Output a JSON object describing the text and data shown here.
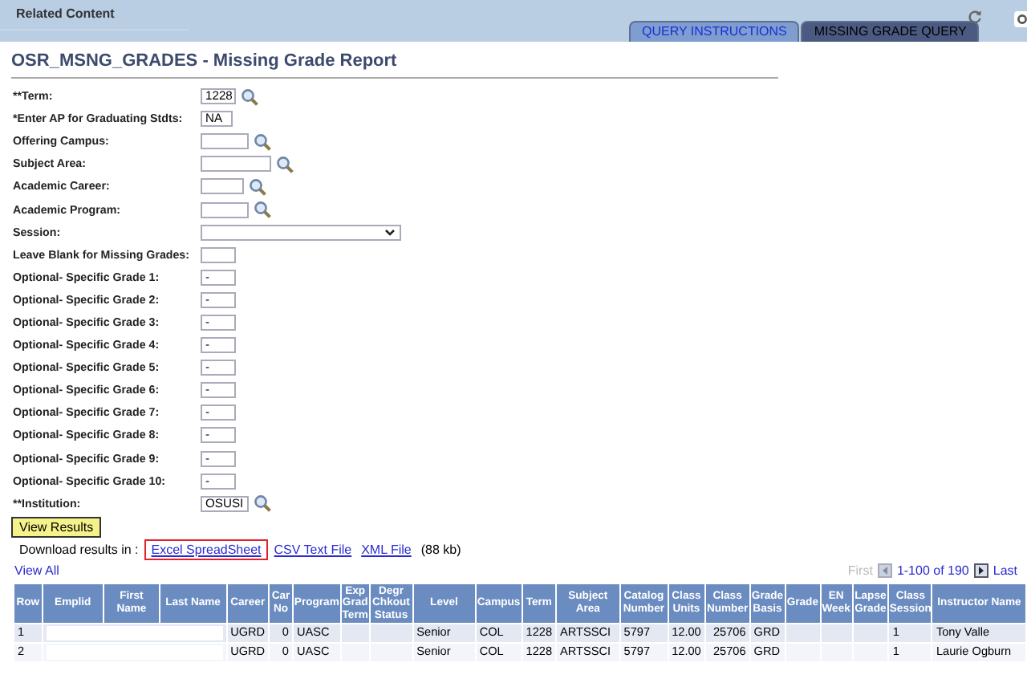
{
  "header": {
    "title": "Related Content"
  },
  "tabs": [
    {
      "label": "QUERY INSTRUCTIONS",
      "selected": false
    },
    {
      "label": "MISSING GRADE QUERY",
      "selected": true
    }
  ],
  "report_title": "OSR_MSNG_GRADES - Missing Grade Report",
  "fields": [
    {
      "label": "**Term:",
      "kind": "lookup",
      "value": "1228"
    },
    {
      "label": "*Enter AP for Graduating Stdts:",
      "kind": "text",
      "value": "NA"
    },
    {
      "label": "Offering Campus:",
      "kind": "lookup"
    },
    {
      "label": "Subject Area:",
      "kind": "lookup"
    },
    {
      "label": "Academic Career:",
      "kind": "lookup"
    },
    {
      "label": "Academic Program:",
      "kind": "lookup"
    },
    {
      "label": "Session:",
      "kind": "select"
    },
    {
      "label": "Leave Blank for Missing Grades:",
      "kind": "text"
    },
    {
      "label": "Optional- Specific Grade 1:",
      "kind": "text",
      "value": "-"
    },
    {
      "label": "Optional- Specific Grade 2:",
      "kind": "text",
      "value": "-"
    },
    {
      "label": "Optional- Specific Grade 3:",
      "kind": "text",
      "value": "-"
    },
    {
      "label": "Optional- Specific Grade 4:",
      "kind": "text",
      "value": "-"
    },
    {
      "label": "Optional- Specific Grade 5:",
      "kind": "text",
      "value": "-"
    },
    {
      "label": "Optional- Specific Grade 6:",
      "kind": "text",
      "value": "-"
    },
    {
      "label": "Optional- Specific Grade 7:",
      "kind": "text",
      "value": "-"
    },
    {
      "label": "Optional- Specific Grade 8:",
      "kind": "text",
      "value": "-"
    },
    {
      "label": "Optional- Specific Grade 9:",
      "kind": "text",
      "value": "-"
    },
    {
      "label": "Optional- Specific Grade 10:",
      "kind": "text",
      "value": "-"
    },
    {
      "label": "**Institution:",
      "kind": "lookup",
      "value": "OSUSI"
    }
  ],
  "view_results": "View Results",
  "download": {
    "label": "Download results in :",
    "links": [
      {
        "label": "Excel SpreadSheet",
        "highlighted": true
      },
      {
        "label": "CSV Text File",
        "highlighted": false
      },
      {
        "label": "XML File",
        "highlighted": false
      }
    ],
    "size": "(88 kb)"
  },
  "view_all": "View All",
  "pagination": {
    "first": "First",
    "range": "1-100 of 190",
    "last": "Last"
  },
  "table": {
    "columns": [
      "Row",
      "Emplid",
      "First Name",
      "Last Name",
      "Career",
      "Car No",
      "Program",
      "Exp Grad Term",
      "Degr Chkout Status",
      "Level",
      "Campus",
      "Term",
      "Subject Area",
      "Catalog Number",
      "Class Units",
      "Class Number",
      "Grade Basis",
      "Grade",
      "EN Week",
      "Lapse Grade",
      "Class Session",
      "Instructor Name"
    ],
    "rows": [
      {
        "redacted": true,
        "cells": [
          "1",
          "",
          "",
          "",
          "UGRD",
          "0",
          "UASC",
          "",
          "",
          "Senior",
          "COL",
          "1228",
          "ARTSSCI",
          "5797",
          "12.00",
          "25706",
          "GRD",
          "",
          "",
          "",
          "1",
          "Tony Valle"
        ]
      },
      {
        "redacted": true,
        "cells": [
          "2",
          "",
          "",
          "",
          "UGRD",
          "0",
          "UASC",
          "",
          "",
          "Senior",
          "COL",
          "1228",
          "ARTSSCI",
          "5797",
          "12.00",
          "25706",
          "GRD",
          "",
          "",
          "",
          "1",
          "Laurie Ogburn"
        ]
      }
    ]
  }
}
